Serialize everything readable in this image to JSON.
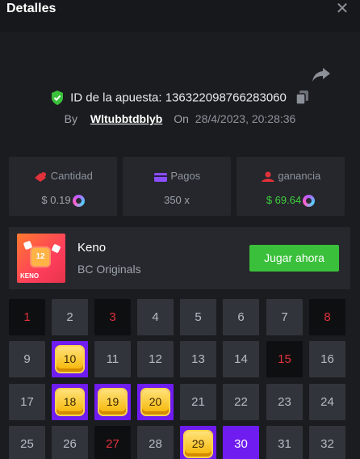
{
  "header": {
    "title": "Detalles"
  },
  "bet": {
    "id_label": "ID de la apuesta:",
    "id": "136322098766283060",
    "by_label": "By",
    "user": "Wltubbtdblyb",
    "on_label": "On",
    "date": "28/4/2023, 20:28:36"
  },
  "stats": {
    "amount": {
      "label": "Cantidad",
      "value": "$ 0.19"
    },
    "payout": {
      "label": "Pagos",
      "value": "350 x"
    },
    "profit": {
      "label": "ganancia",
      "value": "$ 69.64"
    }
  },
  "game": {
    "name": "Keno",
    "provider": "BC Originals",
    "thumb_number": "12",
    "thumb_text": "KENO",
    "play_label": "Jugar ahora"
  },
  "colors": {
    "accent": "#6f1cf0",
    "play": "#3bc03b",
    "miss": "#e0323b",
    "profit": "#3ed13e"
  },
  "keno": {
    "red": [
      1,
      3,
      8,
      15,
      27
    ],
    "hits": [
      10,
      18,
      19,
      20,
      29
    ],
    "selected": [
      30
    ]
  }
}
